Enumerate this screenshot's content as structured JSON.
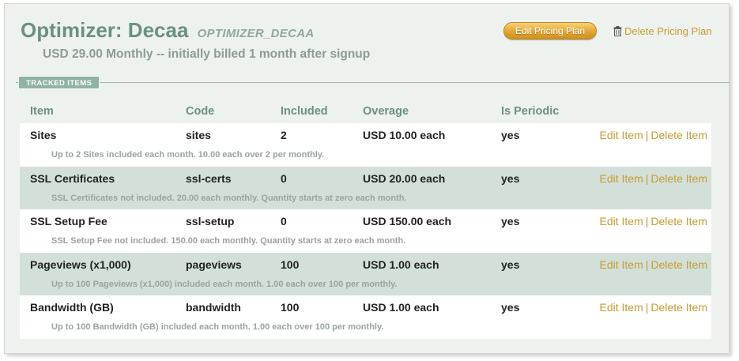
{
  "plan": {
    "title": "Optimizer: Decaa",
    "code": "OPTIMIZER_DECAA",
    "subtitle": "USD 29.00 Monthly -- initially billed 1 month after signup",
    "edit_button": "Edit Pricing Plan",
    "delete_link": "Delete Pricing Plan",
    "delete_icon": "trash-icon"
  },
  "section": {
    "label": "TRACKED ITEMS"
  },
  "table": {
    "headers": {
      "item": "Item",
      "code": "Code",
      "included": "Included",
      "overage": "Overage",
      "periodic": "Is Periodic"
    },
    "rows": [
      {
        "item": "Sites",
        "code": "sites",
        "included": "2",
        "overage": "USD 10.00 each",
        "periodic": "yes",
        "description": "Up to 2 Sites included each month. 10.00 each over 2 per monthly.",
        "edit": "Edit Item",
        "sep": "|",
        "delete": "Delete Item"
      },
      {
        "item": "SSL Certificates",
        "code": "ssl-certs",
        "included": "0",
        "overage": "USD 20.00 each",
        "periodic": "yes",
        "description": "SSL Certificates not included. 20.00 each monthly. Quantity starts at zero each month.",
        "edit": "Edit Item",
        "sep": "|",
        "delete": "Delete Item"
      },
      {
        "item": "SSL Setup Fee",
        "code": "ssl-setup",
        "included": "0",
        "overage": "USD 150.00 each",
        "periodic": "yes",
        "description": "SSL Setup Fee not included. 150.00 each monthly. Quantity starts at zero each month.",
        "edit": "Edit Item",
        "sep": "|",
        "delete": "Delete Item"
      },
      {
        "item": "Pageviews (x1,000)",
        "code": "pageviews",
        "included": "100",
        "overage": "USD 1.00 each",
        "periodic": "yes",
        "description": "Up to 100 Pageviews (x1,000) included each month. 1.00 each over 100 per monthly.",
        "edit": "Edit Item",
        "sep": "|",
        "delete": "Delete Item"
      },
      {
        "item": "Bandwidth (GB)",
        "code": "bandwidth",
        "included": "100",
        "overage": "USD 1.00 each",
        "periodic": "yes",
        "description": "Up to 100 Bandwidth (GB) included each month. 1.00 each over 100 per monthly.",
        "edit": "Edit Item",
        "sep": "|",
        "delete": "Delete Item"
      }
    ]
  },
  "colors": {
    "accent": "#6a9080",
    "link": "#c69b31",
    "button": "#e1a532",
    "alt_row": "#d3e0da",
    "panel": "#eef2ee"
  }
}
